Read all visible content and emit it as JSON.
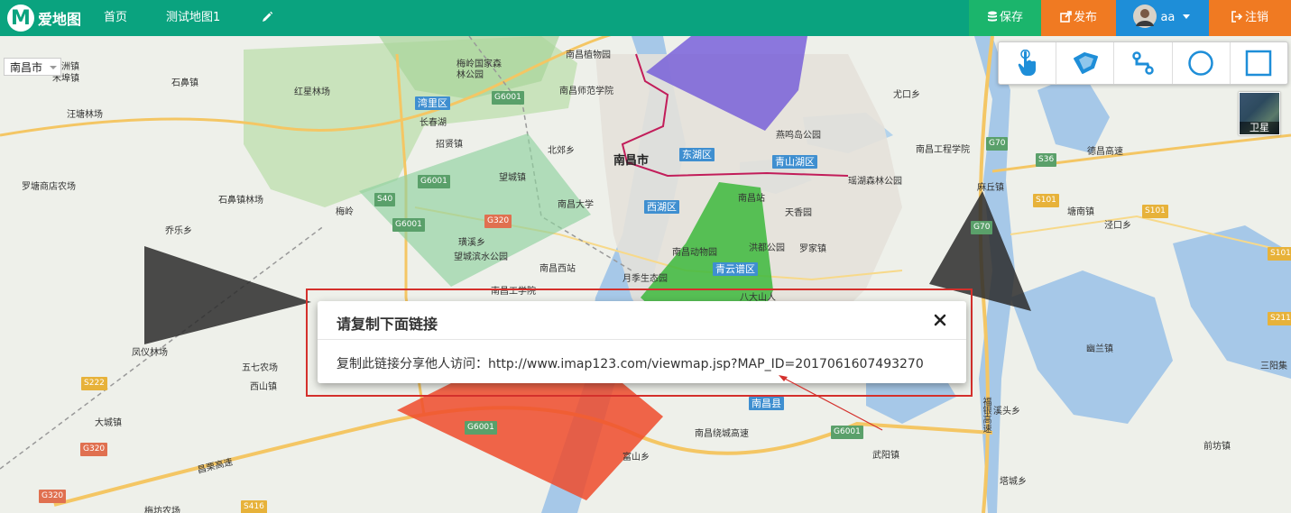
{
  "app": {
    "logo_letter": "M",
    "logo_text": "爱地图",
    "brand_color": "#0aa37f"
  },
  "nav": {
    "home": "首页",
    "map_title": "测试地图1",
    "edit_icon": "pencil-icon"
  },
  "actions": {
    "save": "保存",
    "publish": "发布",
    "user": "aa",
    "logout": "注销",
    "save_color": "#1bb56c",
    "publish_color": "#f07a22",
    "user_color": "#1e8ed8",
    "logout_color": "#f07a22"
  },
  "map": {
    "city_selector": "南昌市",
    "satellite_label": "卫星",
    "tools": [
      "pointer-hand-icon",
      "polygon-icon",
      "polyline-icon",
      "circle-icon",
      "rectangle-icon"
    ],
    "labels": {
      "dongzhou": "东洲镇",
      "shihe": "禾埠镇",
      "shibi": "石鼻镇",
      "hongxing": "红星林场",
      "meiling": "梅岭国家森林公园",
      "nc_zhiwu": "南昌植物园",
      "nc_shifan": "南昌师范学院",
      "wangxi": "汪塘林场",
      "changchun": "长春湖",
      "zhaoxian": "招贤镇",
      "beijiao": "北郊乡",
      "nanchang_city": "南昌市",
      "yanming": "燕鸣岛公园",
      "yaohu": "瑶湖森林公园",
      "nc_gongcheng": "南昌工程学院",
      "youkou": "尤口乡",
      "luotang": "罗塘商店农场",
      "shibi_linchang": "石鼻镇林场",
      "wangcheng": "望城镇",
      "nc_univ": "南昌大学",
      "nc_station": "南昌站",
      "tianxiang": "天香园",
      "qiaole": "乔乐乡",
      "meiling2": "梅岭",
      "yuexi": "璜溪乡",
      "wangcheng_park": "望城滨水公园",
      "nc_dongwu": "南昌动物园",
      "hongdu": "洪都公园",
      "luojia": "罗家镇",
      "nc_west": "南昌西站",
      "yueji": "月季生态园",
      "nc_gongxue": "南昌工学院",
      "bada": "八大山人",
      "mafeng": "麻丘镇",
      "tangnan": "塘南镇",
      "jinkou": "泾口乡",
      "fengyi": "凤仪林场",
      "wuqi": "五七农场",
      "xishan": "西山镇",
      "youlan": "幽兰镇",
      "sanyang": "三阳集",
      "dacheng": "大城镇",
      "nanchang_county": "南昌县",
      "jiantou": "溪头乡",
      "wuyang": "武阳镇",
      "fuchang": "富山乡",
      "qianfang": "前坊镇",
      "tanqiu": "塔城乡",
      "changchun2": "梅坊农场",
      "nc_ring": "南昌绕城高速",
      "changli": "昌栗高速",
      "dechang": "德昌高速",
      "fuyin": "福银高速"
    },
    "districts": {
      "wanli": "湾里区",
      "donghu": "东湖区",
      "qingshanhu": "青山湖区",
      "xihu": "西湖区",
      "qingyunpu": "青云谱区"
    },
    "shields": {
      "g6001_a": "G6001",
      "g6001_b": "G6001",
      "g6001_c": "G6001",
      "g6001_d": "G6001",
      "g6001_e": "G6001",
      "s40": "S40",
      "g320_a": "G320",
      "g320_b": "G320",
      "g320_c": "G320",
      "g70_a": "G70",
      "g70_b": "G70",
      "s36": "S36",
      "s101_a": "S101",
      "s101_b": "S101",
      "s101_c": "S101",
      "s222": "S222",
      "s211": "S211",
      "s416": "S416"
    }
  },
  "dialog": {
    "title": "请复制下面链接",
    "body": "复制此链接分享他人访问：http://www.imap123.com/viewmap.jsp?MAP_ID=2017061607493270",
    "close_icon": "close-icon"
  }
}
